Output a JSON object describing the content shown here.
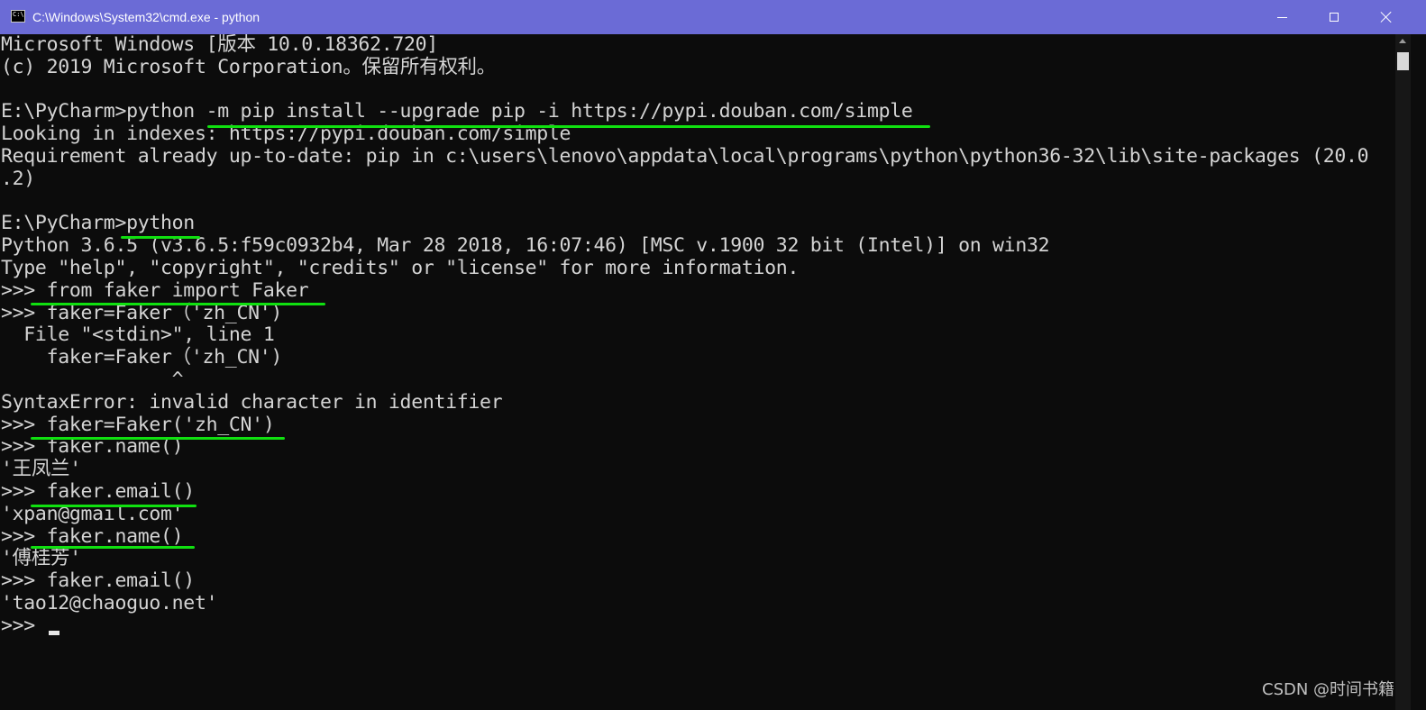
{
  "window": {
    "title": "C:\\Windows\\System32\\cmd.exe - python",
    "title_icon_text": "C:\\",
    "controls": {
      "minimize_icon": "minimize-icon",
      "maximize_icon": "maximize-icon",
      "close_icon": "close-icon"
    },
    "titlebar_color": "#6b6bd6",
    "background_color": "#0c0c0c",
    "text_color": "#d4d4d4",
    "highlight_color": "#10e010"
  },
  "console": {
    "lines": [
      "Microsoft Windows [版本 10.0.18362.720]",
      "(c) 2019 Microsoft Corporation。保留所有权利。",
      "",
      "E:\\PyCharm>python -m pip install --upgrade pip -i https://pypi.douban.com/simple",
      "Looking in indexes: https://pypi.douban.com/simple",
      "Requirement already up-to-date: pip in c:\\users\\lenovo\\appdata\\local\\programs\\python\\python36-32\\lib\\site-packages (20.0",
      ".2)",
      "",
      "E:\\PyCharm>python",
      "Python 3.6.5 (v3.6.5:f59c0932b4, Mar 28 2018, 16:07:46) [MSC v.1900 32 bit (Intel)] on win32",
      "Type \"help\", \"copyright\", \"credits\" or \"license\" for more information.",
      ">>> from faker import Faker",
      ">>> faker=Faker（'zh_CN')",
      "  File \"<stdin>\", line 1",
      "    faker=Faker（'zh_CN')",
      "               ^",
      "SyntaxError: invalid character in identifier",
      ">>> faker=Faker('zh_CN')",
      ">>> faker.name()",
      "'王凤兰'",
      ">>> faker.email()",
      "'xpan@gmail.com'",
      ">>> faker.name()",
      "'傅桂芳'",
      ">>> faker.email()",
      "'tao12@chaoguo.net'",
      ">>> "
    ]
  },
  "watermark": "CSDN @时间书籍"
}
